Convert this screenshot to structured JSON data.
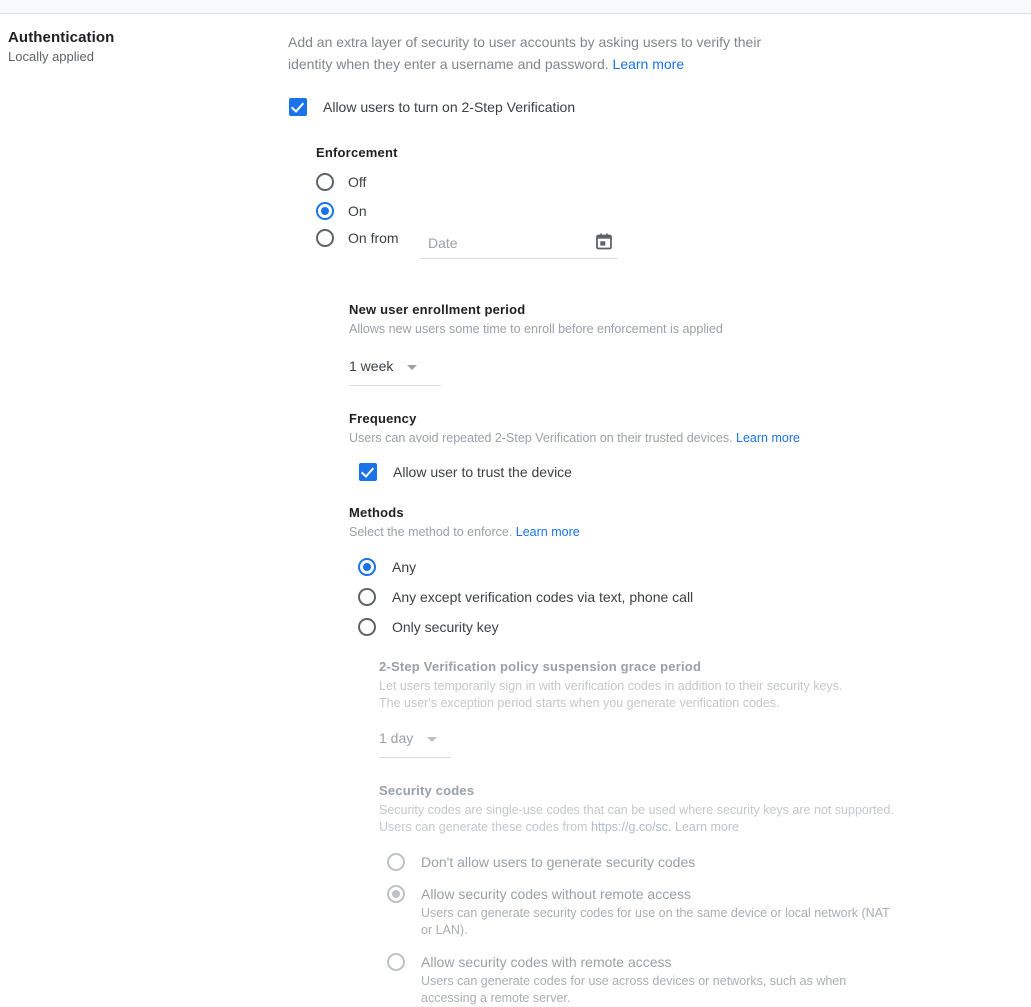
{
  "left_panel": {
    "title": "Authentication",
    "subtitle": "Locally applied"
  },
  "intro": {
    "text": "Add an extra layer of security to user accounts by asking users to verify their identity when they enter a username and password.",
    "learn_more": "Learn more"
  },
  "master_toggle": {
    "label": "Allow users to turn on 2-Step Verification",
    "checked": true
  },
  "enforcement": {
    "title": "Enforcement",
    "options": [
      {
        "label": "Off",
        "selected": false
      },
      {
        "label": "On",
        "selected": true
      },
      {
        "label": "On from",
        "selected": false
      }
    ],
    "date_placeholder": "Date",
    "date_value": "",
    "calendar_icon": "calendar-icon"
  },
  "enrollment": {
    "title": "New user enrollment period",
    "description": "Allows new users some time to enroll before enforcement is applied",
    "value": "1 week"
  },
  "frequency": {
    "title": "Frequency",
    "description": "Users can avoid repeated 2-Step Verification on their trusted devices.",
    "learn_more": "Learn more",
    "checkbox_label": "Allow user to trust the device",
    "checked": true
  },
  "methods": {
    "title": "Methods",
    "description": "Select the method to enforce.",
    "learn_more": "Learn more",
    "options": [
      {
        "label": "Any",
        "selected": true
      },
      {
        "label": "Any except verification codes via text, phone call",
        "selected": false
      },
      {
        "label": "Only security key",
        "selected": false
      }
    ]
  },
  "grace_period": {
    "title": "2-Step Verification policy suspension grace period",
    "description": "Let users temporarily sign in with verification codes in addition to their security keys. The user's exception period starts when you generate verification codes.",
    "value": "1 day",
    "disabled": true
  },
  "security_codes": {
    "title": "Security codes",
    "description_part1": "Security codes are single-use codes that can be used where security keys are not supported. Users can generate these codes from",
    "url": "https://g.co/sc.",
    "learn_more": "Learn more",
    "disabled": true,
    "options": [
      {
        "label": "Don't allow users to generate security codes",
        "selected": false,
        "sub": ""
      },
      {
        "label": "Allow security codes without remote access",
        "selected": true,
        "sub": "Users can generate security codes for use on the same device or local network (NAT or LAN)."
      },
      {
        "label": "Allow security codes with remote access",
        "selected": false,
        "sub": "Users can generate codes for use across devices or networks, such as when accessing a remote server."
      }
    ]
  },
  "colors": {
    "accent": "#1a73e8",
    "text": "#3c4043",
    "muted": "#9aa0a6",
    "disabled": "#bdc1c6"
  }
}
